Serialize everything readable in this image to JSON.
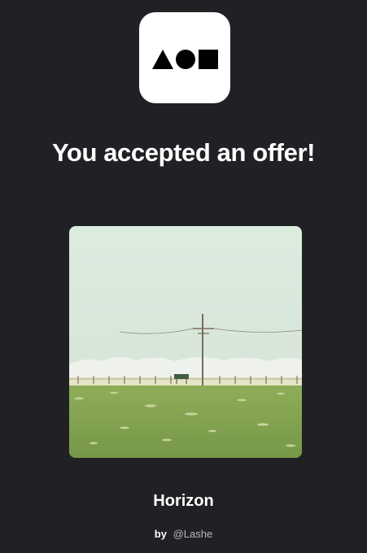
{
  "offer": {
    "headline": "You accepted an offer!",
    "logo_icon": "brand-shapes-logo",
    "artwork_icon": "prairie-landscape-artwork",
    "item_title": "Horizon",
    "by_label": "by",
    "artist_handle": "@Lashe"
  },
  "colors": {
    "background": "#202124",
    "text": "#ffffff",
    "muted_text": "#b8b9bc",
    "logo_tile": "#ffffff",
    "artwork_sky": "#d7e5dc",
    "artwork_grass": "#7c9e4b"
  }
}
